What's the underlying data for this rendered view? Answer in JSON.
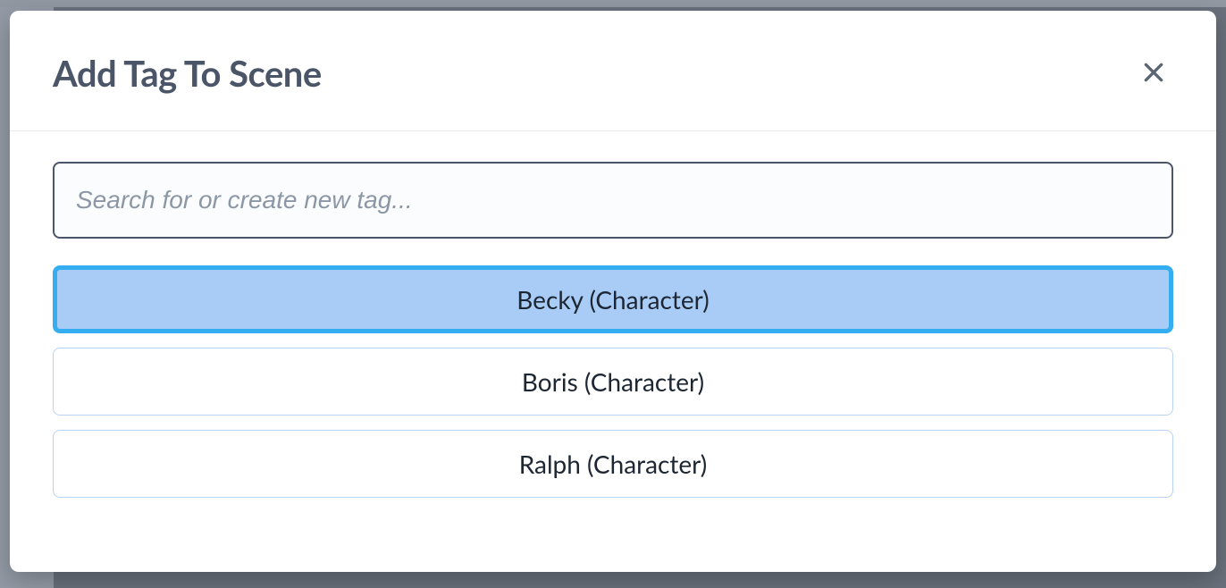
{
  "modal": {
    "title": "Add Tag To Scene",
    "close_icon": "close",
    "search": {
      "value": "",
      "placeholder": "Search for or create new tag..."
    },
    "options": [
      {
        "label": "Becky (Character)",
        "selected": true
      },
      {
        "label": "Boris (Character)",
        "selected": false
      },
      {
        "label": "Ralph (Character)",
        "selected": false
      }
    ]
  }
}
